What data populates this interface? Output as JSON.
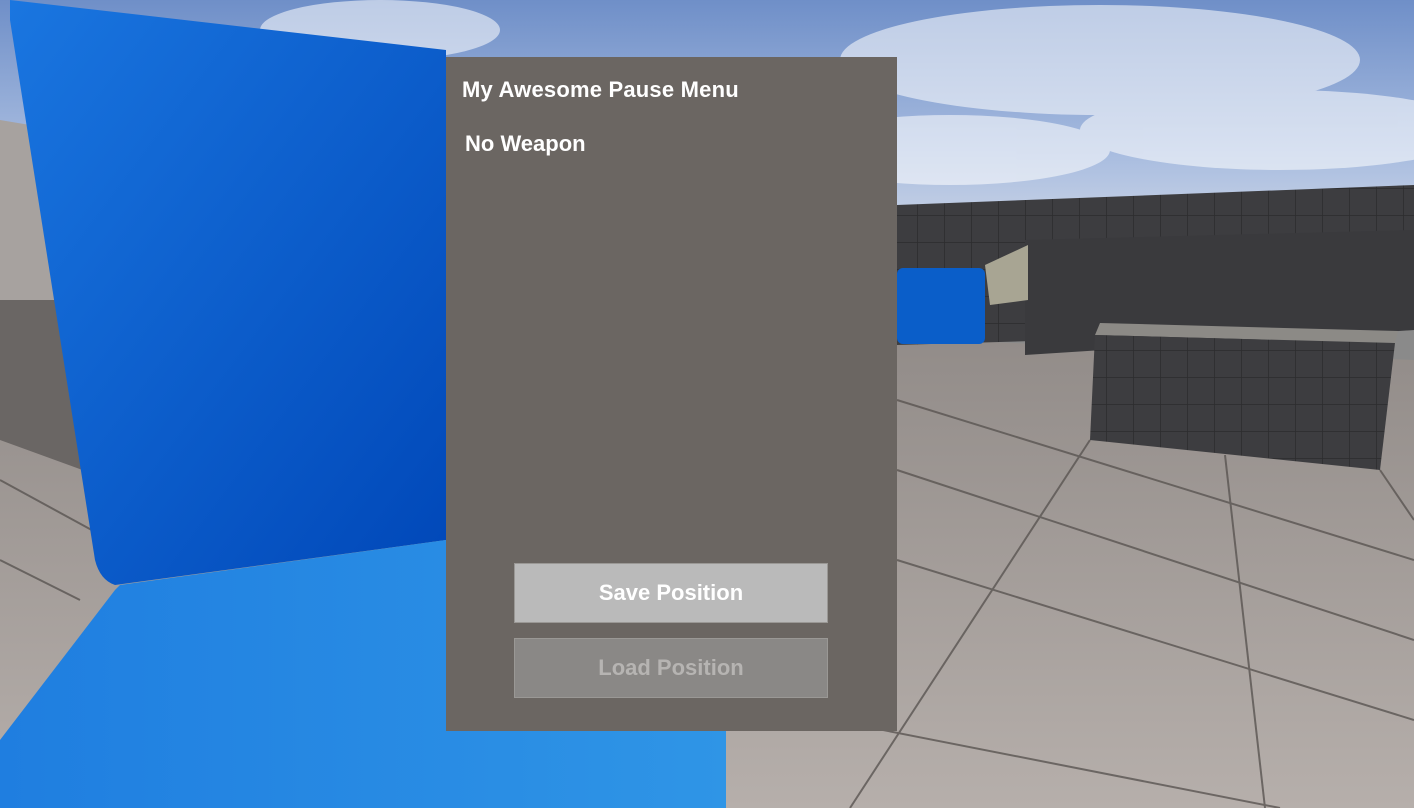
{
  "pause_menu": {
    "title": "My Awesome Pause Menu",
    "weapon_status": "No Weapon",
    "buttons": {
      "save_label": "Save Position",
      "load_label": "Load Position",
      "load_enabled": false
    }
  },
  "colors": {
    "panel_bg": "#6b6662",
    "text": "#ffffff",
    "save_button_bg": "#bababa",
    "load_button_bg_disabled": "#8a8886",
    "load_button_text_disabled": "#b6b4b2",
    "scene_blue": "#0a66cc",
    "sky": "#8aa7d6",
    "floor_tile": "#b9b2ae",
    "wall_dark": "#3c3c3e"
  }
}
